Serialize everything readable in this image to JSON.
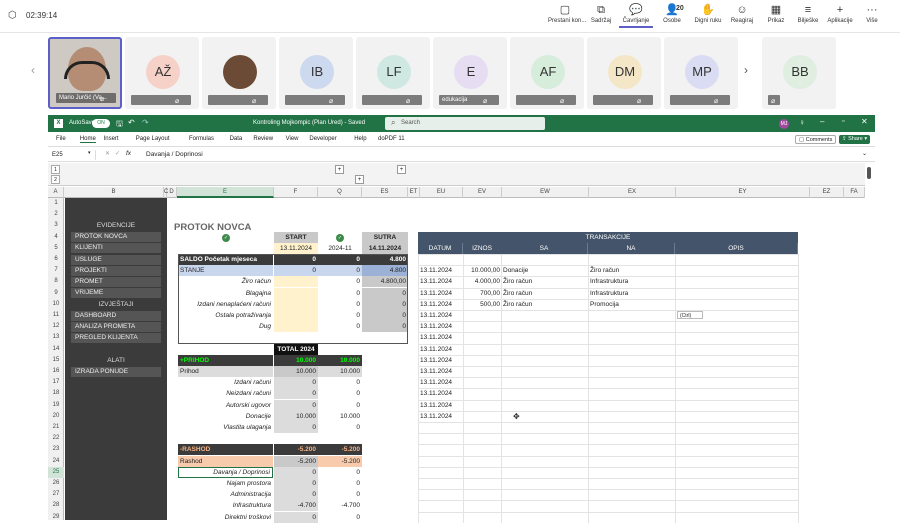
{
  "teams": {
    "timer": "02:39:14",
    "buttons": [
      {
        "label": "Prestani kon...",
        "icon": "▢"
      },
      {
        "label": "Sadržaj",
        "icon": "⧉"
      },
      {
        "label": "Čavrljanje",
        "icon": "💬"
      },
      {
        "label": "Osobe",
        "icon": "👤",
        "count": "20"
      },
      {
        "label": "Digni ruku",
        "icon": "✋"
      },
      {
        "label": "Reagiraj",
        "icon": "☺"
      },
      {
        "label": "Prikaz",
        "icon": "▦"
      },
      {
        "label": "Bilješke",
        "icon": "≡"
      },
      {
        "label": "Aplikacije",
        "icon": "+"
      },
      {
        "label": "Više",
        "icon": "···"
      }
    ]
  },
  "participants": [
    {
      "initials": "",
      "name": "Mario Jurčić (Va...",
      "color": "#d8c7b8"
    },
    {
      "initials": "AŽ",
      "name": "",
      "color": "#f6d1c8"
    },
    {
      "initials": "",
      "name": "",
      "color": "#e9d6c3"
    },
    {
      "initials": "IB",
      "name": "",
      "color": "#cdd9ef"
    },
    {
      "initials": "LF",
      "name": "",
      "color": "#cfe9e2"
    },
    {
      "initials": "E",
      "name": "edukacija",
      "color": "#e6ddf3"
    },
    {
      "initials": "AF",
      "name": "",
      "color": "#d6eddc"
    },
    {
      "initials": "DM",
      "name": "",
      "color": "#f4e7c7"
    },
    {
      "initials": "MP",
      "name": "",
      "color": "#d9dcf2"
    },
    {
      "initials": "BB",
      "name": "",
      "color": "#dfeee1"
    }
  ],
  "excel": {
    "autosave": "AutoSave",
    "autosave_state": "ON",
    "filename": "Kontroling Mojkompic (Plan Ured) - Saved",
    "search": "Search",
    "user_initials": "MJ",
    "menu": [
      "File",
      "Home",
      "Insert",
      "Page Layout",
      "Formulas",
      "Data",
      "Review",
      "View",
      "Developer",
      "Help",
      "doPDF 11"
    ],
    "comments": "Comments",
    "share": "Share",
    "cell_ref": "E25",
    "fx": "fx",
    "formula": "Davanja / Doprinosi",
    "columns": [
      "A",
      "B",
      "C",
      "D",
      "E",
      "F",
      "Q",
      "ES",
      "ET",
      "EU",
      "EV",
      "EW",
      "EX",
      "EY",
      "EZ",
      "FA"
    ],
    "rows": [
      "1",
      "2",
      "3",
      "4",
      "5",
      "6",
      "7",
      "8",
      "9",
      "10",
      "11",
      "12",
      "13",
      "14",
      "15",
      "16",
      "17",
      "18",
      "19",
      "20",
      "21",
      "22",
      "23",
      "24",
      "25",
      "26",
      "27",
      "28",
      "29"
    ],
    "group_levels": [
      "1",
      "2"
    ],
    "group_buttons": [
      "+",
      "+",
      "+"
    ]
  },
  "sidebar": {
    "sections": [
      {
        "title": "EVIDENCIJE",
        "items": [
          "PROTOK NOVCA",
          "KLIJENTI",
          "USLUGE",
          "PROJEKTI",
          "PROMET",
          "VRIJEME"
        ]
      },
      {
        "title": "IZVJEŠTAJI",
        "items": [
          "DASHBOARD",
          "ANALIZA PROMETA",
          "PREGLED KLIJENTA"
        ]
      },
      {
        "title": "ALATI",
        "items": [
          "IZRADA PONUDE"
        ]
      }
    ]
  },
  "sheet": {
    "title": "PROTOK NOVCA",
    "head": {
      "start": "START",
      "sutra": "SUTRA",
      "date_start": "13.11.2024",
      "date_mid": "2024-11",
      "date_sutra": "14.11.2024"
    },
    "saldo": {
      "label": "SALDO Početak mjeseca",
      "v": [
        "0",
        "0",
        "4.800"
      ]
    },
    "stanje": {
      "label": "STANJE",
      "v": [
        "0",
        "0",
        "4.800"
      ]
    },
    "accounts": [
      {
        "label": "Žiro račun",
        "v": [
          "",
          "0",
          "4.800,00"
        ]
      },
      {
        "label": "Blagajna",
        "v": [
          "",
          "0",
          "0"
        ]
      },
      {
        "label": "Izdani nenaplaćeni računi",
        "v": [
          "",
          "0",
          "0"
        ]
      },
      {
        "label": "Ostala potraživanja",
        "v": [
          "",
          "0",
          "0"
        ]
      },
      {
        "label": "Dug",
        "v": [
          "",
          "0",
          "0"
        ]
      }
    ],
    "total_label": "TOTAL 2024",
    "prihod_h": {
      "label": "+PRIHOD",
      "v": [
        "10.000",
        "10.000"
      ]
    },
    "prihod": {
      "label": "Prihod",
      "v": [
        "10.000",
        "10.000"
      ]
    },
    "prihod_items": [
      {
        "label": "Izdani računi",
        "v": [
          "0",
          "0"
        ]
      },
      {
        "label": "Neizdani računi",
        "v": [
          "0",
          "0"
        ]
      },
      {
        "label": "Autorski ugovor",
        "v": [
          "0",
          "0"
        ]
      },
      {
        "label": "Donacije",
        "v": [
          "10.000",
          "10.000"
        ]
      },
      {
        "label": "Vlastita ulaganja",
        "v": [
          "0",
          "0"
        ]
      }
    ],
    "rashod_h": {
      "label": "-RASHOD",
      "v": [
        "-5.200",
        "-5.200"
      ]
    },
    "rashod": {
      "label": "Rashod",
      "v": [
        "-5.200",
        "-5.200"
      ]
    },
    "rashod_items": [
      {
        "label": "Davanja / Doprinosi",
        "v": [
          "0",
          "0"
        ]
      },
      {
        "label": "Najam prostora",
        "v": [
          "0",
          "0"
        ]
      },
      {
        "label": "Administracija",
        "v": [
          "0",
          "0"
        ]
      },
      {
        "label": "Infrastruktura",
        "v": [
          "-4.700",
          "-4.700"
        ]
      },
      {
        "label": "Direktni troškovi",
        "v": [
          "0",
          "0"
        ]
      }
    ]
  },
  "transakcije": {
    "title": "TRANSAKCIJE",
    "headers": [
      "DATUM",
      "IZNOS",
      "SA",
      "NA",
      "OPIS"
    ],
    "rows": [
      [
        "13.11.2024",
        "10.000,00",
        "Donacije",
        "Žiro račun"
      ],
      [
        "13.11.2024",
        "4.000,00",
        "Žiro račun",
        "Infrastruktura"
      ],
      [
        "13.11.2024",
        "700,00",
        "Žiro račun",
        "Infrastruktura"
      ],
      [
        "13.11.2024",
        "500,00",
        "Žiro račun",
        "Promocija"
      ],
      [
        "13.11.2024",
        "",
        "",
        ""
      ],
      [
        "13.11.2024",
        "",
        "",
        ""
      ],
      [
        "13.11.2024",
        "",
        "",
        ""
      ],
      [
        "13.11.2024",
        "",
        "",
        ""
      ],
      [
        "13.11.2024",
        "",
        "",
        ""
      ],
      [
        "13.11.2024",
        "",
        "",
        ""
      ],
      [
        "13.11.2024",
        "",
        "",
        ""
      ],
      [
        "13.11.2024",
        "",
        "",
        ""
      ],
      [
        "13.11.2024",
        "",
        "",
        ""
      ],
      [
        "13.11.2024",
        "",
        "",
        ""
      ]
    ],
    "paste_tag": "(Ctrl)"
  }
}
